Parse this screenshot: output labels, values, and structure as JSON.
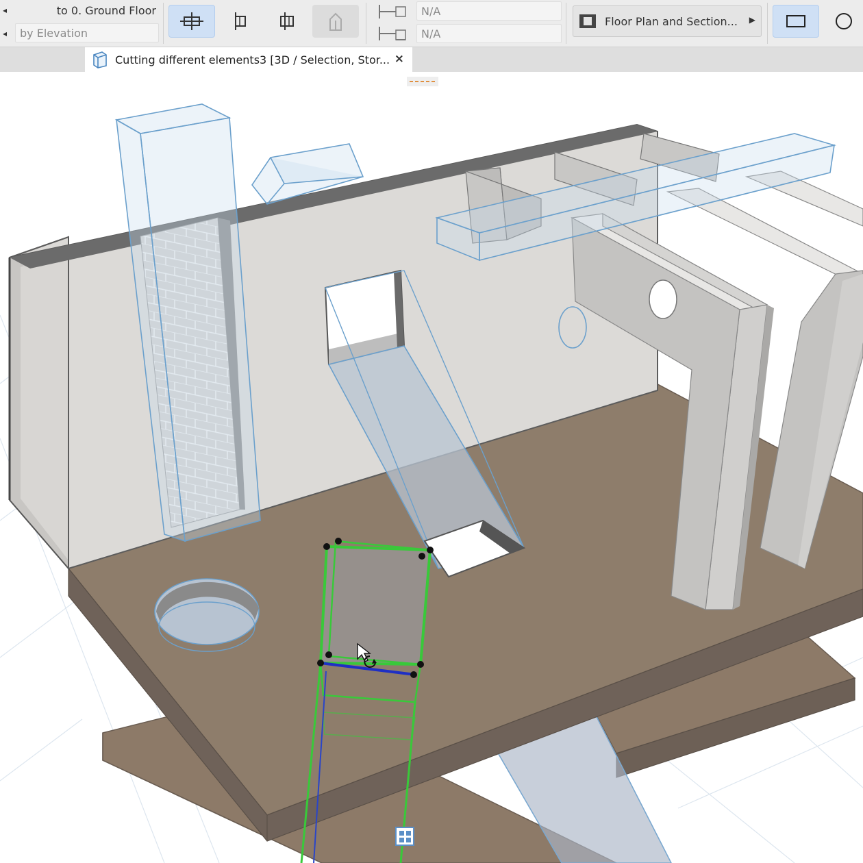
{
  "infobox": {
    "top_link_label": "to 0. Ground Floor",
    "bottom_link_label": "by Elevation",
    "top_value": "N/A",
    "bottom_value": "N/A",
    "view_option": "Floor Plan and Section..."
  },
  "tab": {
    "title": "Cutting different elements3 [3D / Selection, Stor...",
    "close": "×"
  },
  "colors": {
    "toolbar_bg": "#ececec",
    "active_button": "#cfe0f5",
    "selection_green": "#39c93a",
    "edge_blue": "#1f2fc4",
    "ghost_blue": "#7aa8d0",
    "floor": "#8e7d6b",
    "wall": "#dcdad7"
  }
}
